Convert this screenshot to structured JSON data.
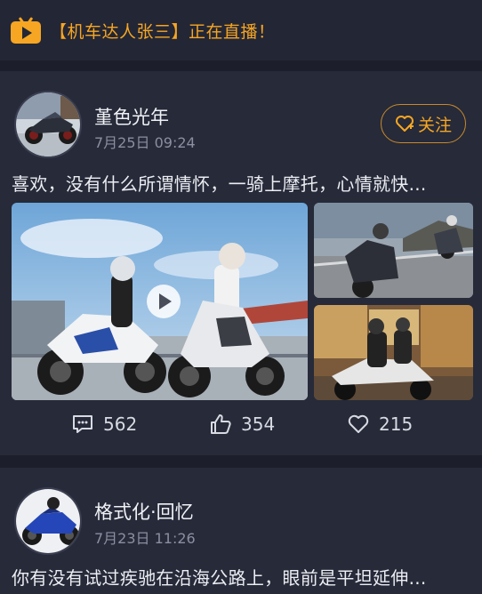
{
  "live_banner": {
    "text": "【机车达人张三】正在直播！",
    "icon": "tv-live-icon",
    "color": "#f6a623"
  },
  "posts": [
    {
      "user": "堇色光年",
      "time": "7月25日 09:24",
      "follow_label": "关注",
      "text": "喜欢，没有什么所谓情怀，一骑上摩托，心情就快...",
      "stats": {
        "comments": "562",
        "likes": "354",
        "favorites": "215"
      }
    },
    {
      "user": "格式化·回忆",
      "time": "7月23日 11:26",
      "text": "你有没有试过疾驰在沿海公路上，眼前是平坦延伸..."
    }
  ],
  "colors": {
    "accent": "#f6a623",
    "background": "#1c1e2b",
    "card": "#262a39"
  }
}
